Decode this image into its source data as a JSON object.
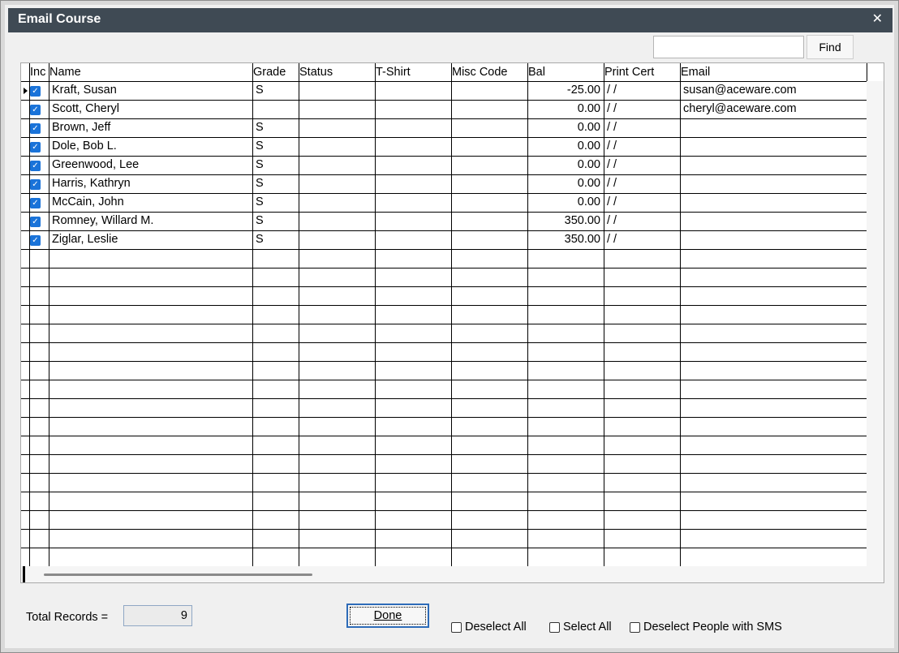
{
  "window": {
    "title": "Email Course",
    "close_glyph": "✕"
  },
  "search": {
    "value": "",
    "placeholder": "",
    "find_label": "Find"
  },
  "grid": {
    "columns": [
      "Inc",
      "Name",
      "Grade",
      "Status",
      "T-Shirt",
      "Misc Code",
      "Bal",
      "Print Cert",
      "Email"
    ],
    "rows": [
      {
        "inc": true,
        "name": "Kraft, Susan",
        "grade": "S",
        "status": "",
        "tshirt": "",
        "misc": "",
        "bal": "-25.00",
        "cert": "/  /",
        "email": "susan@aceware.com"
      },
      {
        "inc": true,
        "name": "Scott, Cheryl",
        "grade": "",
        "status": "",
        "tshirt": "",
        "misc": "",
        "bal": "0.00",
        "cert": "/  /",
        "email": "cheryl@aceware.com"
      },
      {
        "inc": true,
        "name": "Brown, Jeff",
        "grade": "S",
        "status": "",
        "tshirt": "",
        "misc": "",
        "bal": "0.00",
        "cert": "/  /",
        "email": ""
      },
      {
        "inc": true,
        "name": "Dole, Bob L.",
        "grade": "S",
        "status": "",
        "tshirt": "",
        "misc": "",
        "bal": "0.00",
        "cert": "/  /",
        "email": ""
      },
      {
        "inc": true,
        "name": "Greenwood, Lee",
        "grade": "S",
        "status": "",
        "tshirt": "",
        "misc": "",
        "bal": "0.00",
        "cert": "/  /",
        "email": ""
      },
      {
        "inc": true,
        "name": "Harris, Kathryn",
        "grade": "S",
        "status": "",
        "tshirt": "",
        "misc": "",
        "bal": "0.00",
        "cert": "/  /",
        "email": ""
      },
      {
        "inc": true,
        "name": "McCain, John",
        "grade": "S",
        "status": "",
        "tshirt": "",
        "misc": "",
        "bal": "0.00",
        "cert": "/  /",
        "email": ""
      },
      {
        "inc": true,
        "name": "Romney, Willard M.",
        "grade": "S",
        "status": "",
        "tshirt": "",
        "misc": "",
        "bal": "350.00",
        "cert": "/  /",
        "email": ""
      },
      {
        "inc": true,
        "name": "Ziglar, Leslie",
        "grade": "S",
        "status": "",
        "tshirt": "",
        "misc": "",
        "bal": "350.00",
        "cert": "/  /",
        "email": ""
      }
    ],
    "current_row": 0
  },
  "footer": {
    "total_label": "Total Records =",
    "total_value": "9",
    "done_label": "Done",
    "deselect_all_label": "Deselect All",
    "select_all_label": "Select All",
    "deselect_sms_label": "Deselect People with SMS"
  },
  "colors": {
    "titlebar": "#3f4a54",
    "checkbox_checked": "#1a73d9",
    "done_border": "#2d6bb8"
  }
}
